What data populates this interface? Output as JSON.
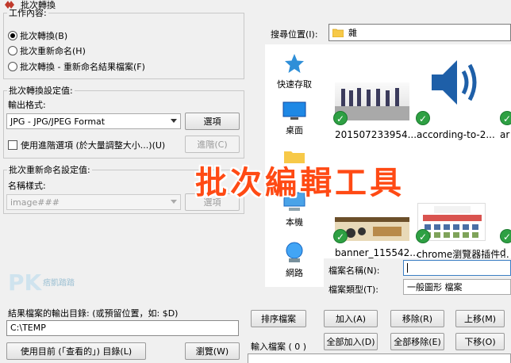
{
  "window": {
    "title": "批次轉換"
  },
  "job": {
    "legend": "工作內容:",
    "options": [
      "批次轉換(B)",
      "批次重新命名(H)",
      "批次轉換 - 重新命名結果檔案(F)"
    ]
  },
  "convert": {
    "legend": "批次轉換設定值:",
    "format_label": "輸出格式:",
    "format_value": "JPG - JPG/JPEG Format",
    "options_button": "選項",
    "advanced_checkbox": "使用進階選項 (於大量調整大小...)(U)",
    "advanced_button": "進階(C)"
  },
  "rename": {
    "legend": "批次重新命名設定值:",
    "pattern_label": "名稱樣式:",
    "pattern_value": "image###",
    "options_button": "選項"
  },
  "watermark": {
    "text": "痞凱踏踏"
  },
  "output": {
    "label": "結果檔案的輸出目錄: (或預留位置，如: $D)",
    "value": "C:\\TEMP",
    "use_current_button": "使用目前 (「查看的」) 目錄(L)",
    "browse_button": "瀏覽(W)"
  },
  "browser": {
    "lookin_label": "搜尋位置(I):",
    "lookin_value": "雜",
    "places": [
      "快速存取",
      "桌面",
      "本機",
      "網路"
    ],
    "files": [
      "201507233954...",
      "according-to-2...",
      "ar"
    ],
    "files_row2": [
      "banner_115542...",
      "chrome瀏覽器插件...",
      "d"
    ],
    "filename_label": "檔案名稱(N):",
    "filename_value": "",
    "filetype_label": "檔案類型(T):",
    "filetype_value": "一般圖形 檔案"
  },
  "actions": {
    "sort": "排序檔案",
    "add": "加入(A)",
    "remove": "移除(R)",
    "up": "上移(M)",
    "add_all": "全部加入(D)",
    "remove_all": "全部移除(E)",
    "down": "下移(O)",
    "input_files_label": "輸入檔案 ( 0 )"
  },
  "overlay": {
    "text": "批次編輯工具"
  },
  "colors": {
    "overlay": "#ff4a14",
    "check": "#2ea043",
    "speaker": "#1e5fa8",
    "folder": "#f7c948"
  }
}
